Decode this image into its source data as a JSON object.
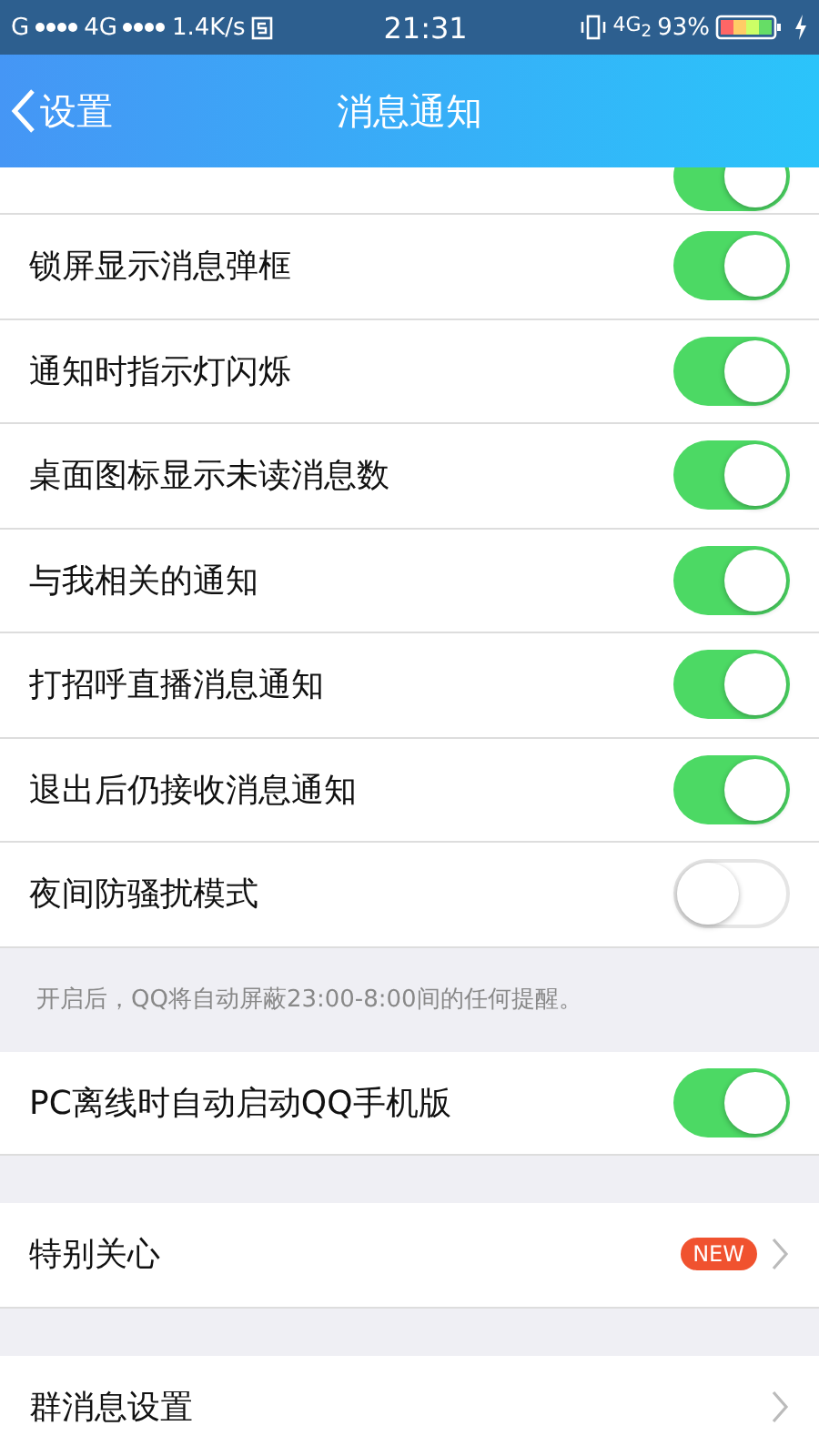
{
  "status_bar": {
    "network_1": "G",
    "network_2": "4G",
    "speed": "1.4K/s",
    "time": "21:31",
    "network_3": "4G$_{2}$",
    "battery": "93%"
  },
  "nav": {
    "back": "设置",
    "title": "消息通知"
  },
  "partial_row": {
    "on": true
  },
  "settings": [
    {
      "label": "锁屏显示消息弹框",
      "on": true
    },
    {
      "label": "通知时指示灯闪烁",
      "on": true
    },
    {
      "label": "桌面图标显示未读消息数",
      "on": true
    },
    {
      "label": "与我相关的通知",
      "on": true
    },
    {
      "label": "打招呼直播消息通知",
      "on": true
    },
    {
      "label": "退出后仍接收消息通知",
      "on": true
    },
    {
      "label": "夜间防骚扰模式",
      "on": false
    }
  ],
  "note": "开启后，QQ将自动屏蔽23:00-8:00间的任何提醒。",
  "pc_row": {
    "label": "PC离线时自动启动QQ手机版",
    "on": true
  },
  "links": [
    {
      "label": "特别关心",
      "badge": "NEW"
    },
    {
      "label": "群消息设置"
    }
  ]
}
